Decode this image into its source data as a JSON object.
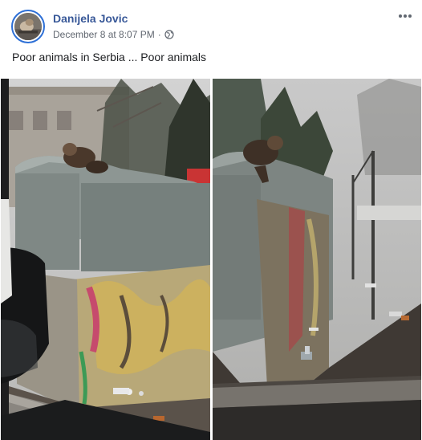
{
  "post": {
    "author_name": "Danijela Jovic",
    "timestamp": "December 8 at 8:07 PM",
    "separator": "·",
    "privacy_icon": "globe-icon",
    "more_icon": "more-options-icon",
    "text": "Poor animals in Serbia ... Poor animals",
    "photos": [
      {
        "name": "photo-dog-on-dumpster-1",
        "description_icon": "photo"
      },
      {
        "name": "photo-dog-on-dumpster-2",
        "description_icon": "photo"
      }
    ]
  },
  "colors": {
    "author_link": "#385898",
    "meta_text": "#616770",
    "avatar_ring": "#2d6fd6"
  }
}
